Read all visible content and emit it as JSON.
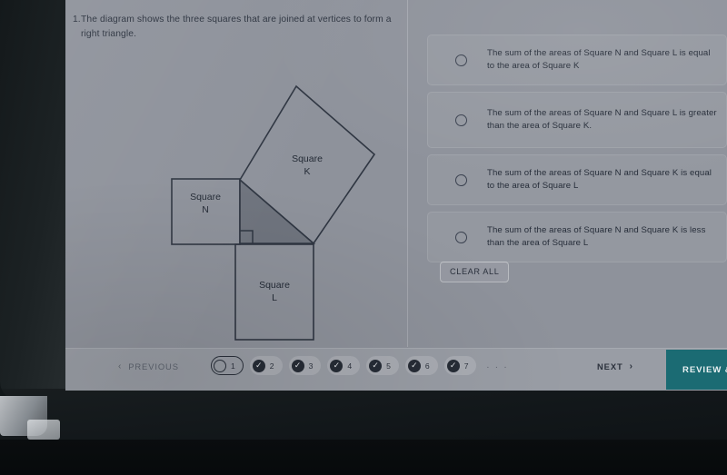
{
  "question": {
    "number": "1.",
    "text": "The diagram shows the three squares that are joined at vertices to form a right triangle."
  },
  "diagram": {
    "square_n_label_line1": "Square",
    "square_n_label_line2": "N",
    "square_k_label_line1": "Square",
    "square_k_label_line2": "K",
    "square_l_label_line1": "Square",
    "square_l_label_line2": "L"
  },
  "options": [
    {
      "id": "option-a",
      "text": "The sum of the areas of Square N and Square L is equal to the area of Square K",
      "selected": false
    },
    {
      "id": "option-b",
      "text": "The sum of the areas of Square N and Square L is greater than the area of Square K.",
      "selected": false
    },
    {
      "id": "option-c",
      "text": "The sum of the areas of Square N and Square K is equal to the area of Square L",
      "selected": false
    },
    {
      "id": "option-d",
      "text": "The sum of the areas of Square N and Square K is less than the area of Square L",
      "selected": false
    }
  ],
  "clear_all_label": "CLEAR ALL",
  "footer": {
    "previous_label": "PREVIOUS",
    "previous_chevron": "‹",
    "next_label": "NEXT",
    "next_chevron": "›",
    "review_label": "REVIEW & SUBMIT",
    "ellipsis": ". . .",
    "pages": [
      {
        "num": "1",
        "state": "current",
        "mark": ""
      },
      {
        "num": "2",
        "state": "answered",
        "mark": "✓"
      },
      {
        "num": "3",
        "state": "answered",
        "mark": "✓"
      },
      {
        "num": "4",
        "state": "answered",
        "mark": "✓"
      },
      {
        "num": "5",
        "state": "answered",
        "mark": "✓"
      },
      {
        "num": "6",
        "state": "answered",
        "mark": "✓"
      },
      {
        "num": "7",
        "state": "answered",
        "mark": "✓"
      }
    ]
  },
  "colors": {
    "screen_bg": "#8e929b",
    "text": "#2d3440",
    "accent_teal": "#1b6b73",
    "stroke": "#2f3642"
  }
}
